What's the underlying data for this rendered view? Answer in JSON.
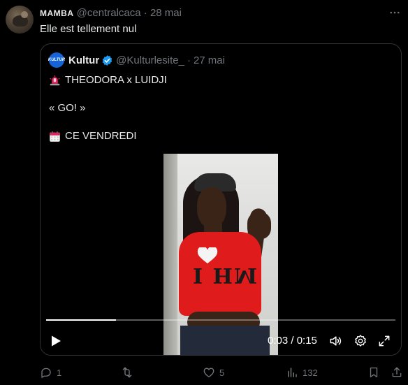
{
  "tweet": {
    "name": "MAMBA",
    "handle": "@centralcaca",
    "separator": "·",
    "date": "28 mai",
    "text": "Elle est tellement nul",
    "more_icon": "more-dots-icon"
  },
  "quote": {
    "avatar_text": "KULTUR",
    "name": "Kultur",
    "handle": "@Kulturlesite_",
    "separator": "·",
    "date": "27 mai",
    "line1": "THEODORA x LUIDJI",
    "line2": "« GO! »",
    "line3": "CE VENDREDI",
    "line1_icon": "siren-emoji",
    "line3_icon": "calendar-emoji",
    "verified_color": "#1d9bf0"
  },
  "video": {
    "progress": 0.2,
    "time": "0:03 / 0:15",
    "shirt_text": "I HM"
  },
  "actions": {
    "reply_count": "1",
    "retweet_count": "",
    "like_count": "5",
    "views_count": "132"
  },
  "colors": {
    "background": "#000000",
    "text": "#e7e9ea",
    "muted": "#71767b",
    "border": "#2f3336",
    "accent": "#1d9bf0"
  }
}
